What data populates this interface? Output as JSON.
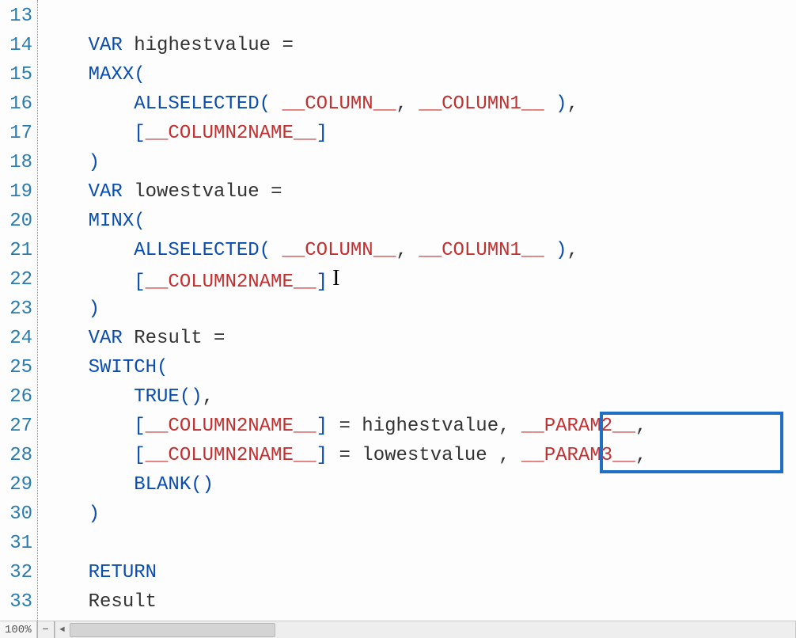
{
  "gutter": {
    "start": 13,
    "end": 33
  },
  "code": {
    "l13": "",
    "indent1": "    ",
    "indent2": "        ",
    "var": "VAR",
    "highestvalue": "highestvalue",
    "eq": " =",
    "maxx": "MAXX",
    "open": "(",
    "close": ")",
    "comma": ",",
    "commasp": ", ",
    "allselected": "ALLSELECTED",
    "column": "__COLUMN__",
    "column1": "__COLUMN1__",
    "lbr": "[",
    "rbr": "]",
    "column2name": "__COLUMN2NAME__",
    "lowestvalue": "lowestvalue",
    "minx": "MINX",
    "result": "Result",
    "switch": "SWITCH",
    "true": "TRUE",
    "unit": "()",
    "eq_highest": " = highestvalue, ",
    "eq_lowest": " = lowestvalue , ",
    "param2": "__PARAM2__",
    "param3": "__PARAM3__",
    "blank": "BLANK",
    "return": "RETURN",
    "result_l": "Result"
  },
  "statusbar": {
    "zoom": "100%",
    "minus": "−",
    "arrow_left": "◄"
  }
}
